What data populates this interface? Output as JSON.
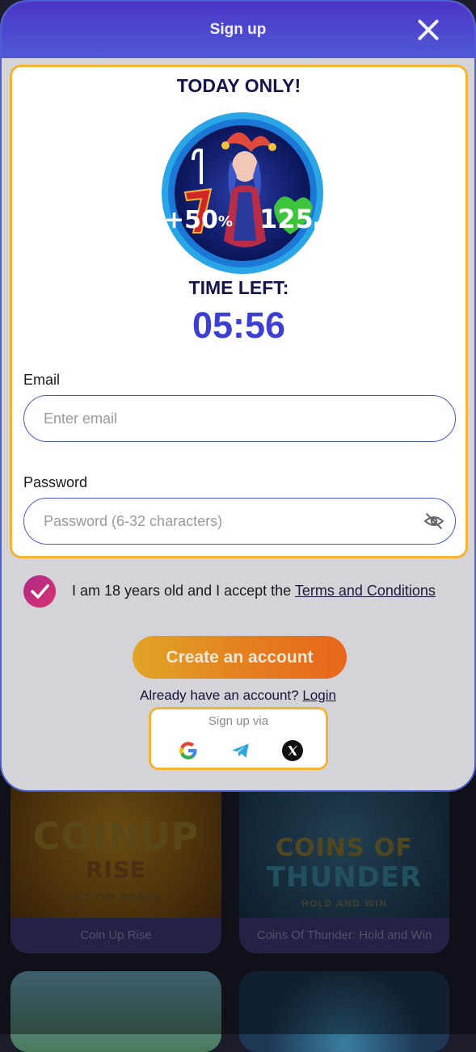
{
  "modal": {
    "title": "Sign up",
    "close_icon": "close-icon"
  },
  "promo": {
    "headline": "TODAY ONLY!",
    "badge_bonus_percent": "+50",
    "badge_percent_sign": "%",
    "badge_free_spins": "125",
    "badge_fs_label": "FS",
    "time_left_label": "TIME LEFT:",
    "timer": "05:56"
  },
  "form": {
    "email_label": "Email",
    "email_placeholder": "Enter email",
    "password_label": "Password",
    "password_placeholder": "Password (6-32 characters)",
    "password_toggle_icon": "eye-off-icon"
  },
  "terms": {
    "checked": true,
    "text": "I am 18 years old and I accept the ",
    "link": "Terms and Conditions"
  },
  "actions": {
    "create_account": "Create an account",
    "already_have": "Already have an account? ",
    "login": "Login"
  },
  "social": {
    "label": "Sign up via",
    "providers": [
      "google-icon",
      "telegram-icon",
      "x-icon"
    ]
  },
  "background_games": [
    {
      "caption": "Coin Up Rise",
      "art_title": "COINUP",
      "art_subtitle": "RISE",
      "art_tag": "HIT THE BONUS"
    },
    {
      "caption": "Coins Of Thunder: Hold and Win",
      "art_title": "COINS OF",
      "art_subtitle": "THUNDER",
      "art_tag": "HOLD AND WIN"
    }
  ],
  "colors": {
    "header": "#4c35c7",
    "accent_border": "#f3b334",
    "timer": "#3d3fd3",
    "cta": "#e57b1e",
    "checkbox": "#c02c7c"
  }
}
